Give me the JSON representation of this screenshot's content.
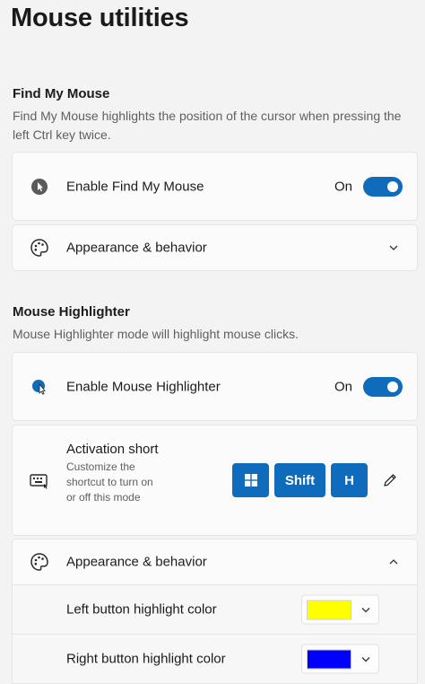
{
  "page": {
    "title": "Mouse utilities"
  },
  "find_my_mouse": {
    "title": "Find My Mouse",
    "description": "Find My Mouse highlights the position of the cursor when pressing the left Ctrl key twice.",
    "enable_label": "Enable Find My Mouse",
    "toggle_text": "On",
    "appearance_label": "Appearance & behavior",
    "icon": "find-mouse-icon"
  },
  "mouse_highlighter": {
    "title": "Mouse Highlighter",
    "description": "Mouse Highlighter mode will highlight mouse clicks.",
    "enable_label": "Enable Mouse Highlighter",
    "toggle_text": "On",
    "shortcut": {
      "title": "Activation short",
      "description": "Customize the shortcut to turn on or off this mode",
      "keys": [
        "⊞",
        "Shift",
        "H"
      ]
    },
    "appearance_label": "Appearance & behavior",
    "left_color_label": "Left button highlight color",
    "right_color_label": "Right button highlight color",
    "left_color": "#ffff00",
    "right_color": "#0000ff",
    "accent": "#0f6cbd"
  }
}
